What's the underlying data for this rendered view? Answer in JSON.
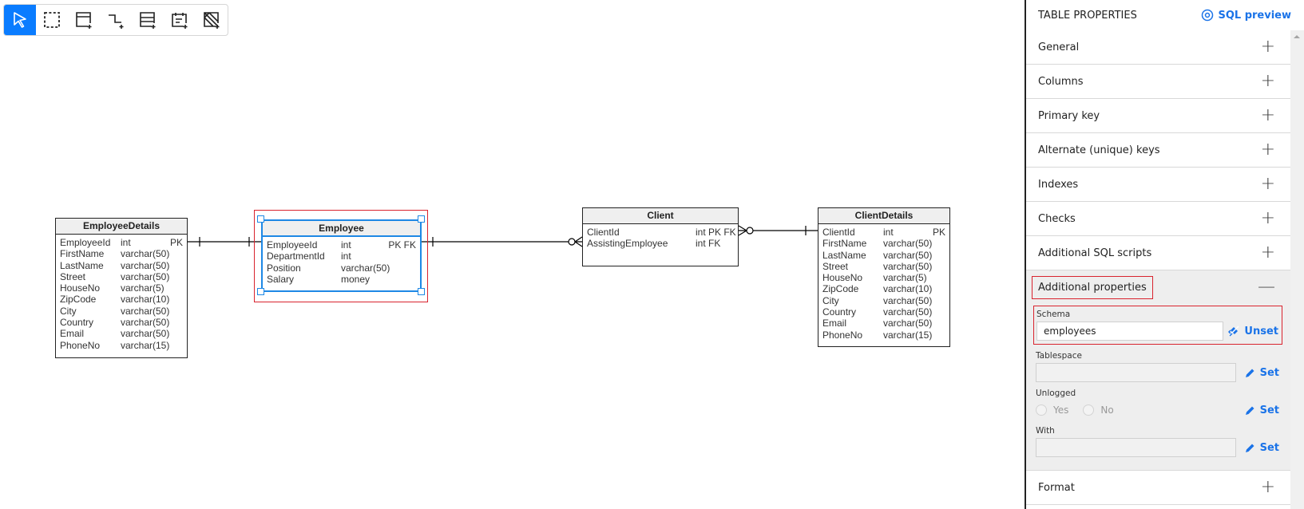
{
  "toolbar": {
    "tools": [
      {
        "name": "select-tool",
        "icon": "pointer-icon",
        "active": true
      },
      {
        "name": "marquee-tool",
        "icon": "dashed-rectangle-icon",
        "active": false
      },
      {
        "name": "add-table-tool",
        "icon": "add-table-icon",
        "active": false
      },
      {
        "name": "add-relationship-tool",
        "icon": "add-relationship-icon",
        "active": false
      },
      {
        "name": "add-view-tool",
        "icon": "add-view-icon",
        "active": false
      },
      {
        "name": "add-note-tool",
        "icon": "add-note-icon",
        "active": false
      },
      {
        "name": "add-area-tool",
        "icon": "add-hatched-area-icon",
        "active": false
      }
    ]
  },
  "diagram": {
    "tables": {
      "employee_details": {
        "name": "EmployeeDetails",
        "columns": [
          {
            "name": "EmployeeId",
            "type": "int",
            "key": "PK"
          },
          {
            "name": "FirstName",
            "type": "varchar(50)",
            "key": ""
          },
          {
            "name": "LastName",
            "type": "varchar(50)",
            "key": ""
          },
          {
            "name": "Street",
            "type": "varchar(50)",
            "key": ""
          },
          {
            "name": "HouseNo",
            "type": "varchar(5)",
            "key": ""
          },
          {
            "name": "ZipCode",
            "type": "varchar(10)",
            "key": ""
          },
          {
            "name": "City",
            "type": "varchar(50)",
            "key": ""
          },
          {
            "name": "Country",
            "type": "varchar(50)",
            "key": ""
          },
          {
            "name": "Email",
            "type": "varchar(50)",
            "key": ""
          },
          {
            "name": "PhoneNo",
            "type": "varchar(15)",
            "key": ""
          }
        ]
      },
      "employee": {
        "name": "Employee",
        "selected": true,
        "columns": [
          {
            "name": "EmployeeId",
            "type": "int",
            "key": "PK FK"
          },
          {
            "name": "DepartmentId",
            "type": "int",
            "key": ""
          },
          {
            "name": "Position",
            "type": "varchar(50)",
            "key": ""
          },
          {
            "name": "Salary",
            "type": "money",
            "key": ""
          }
        ]
      },
      "client": {
        "name": "Client",
        "columns": [
          {
            "name": "ClientId",
            "type": "int PK FK",
            "key": ""
          },
          {
            "name": "AssistingEmployee",
            "type": "int FK",
            "key": ""
          }
        ]
      },
      "client_details": {
        "name": "ClientDetails",
        "columns": [
          {
            "name": "ClientId",
            "type": "int",
            "key": "PK"
          },
          {
            "name": "FirstName",
            "type": "varchar(50)",
            "key": ""
          },
          {
            "name": "LastName",
            "type": "varchar(50)",
            "key": ""
          },
          {
            "name": "Street",
            "type": "varchar(50)",
            "key": ""
          },
          {
            "name": "HouseNo",
            "type": "varchar(5)",
            "key": ""
          },
          {
            "name": "ZipCode",
            "type": "varchar(10)",
            "key": ""
          },
          {
            "name": "City",
            "type": "varchar(50)",
            "key": ""
          },
          {
            "name": "Country",
            "type": "varchar(50)",
            "key": ""
          },
          {
            "name": "Email",
            "type": "varchar(50)",
            "key": ""
          },
          {
            "name": "PhoneNo",
            "type": "varchar(15)",
            "key": ""
          }
        ]
      }
    },
    "relationships": [
      {
        "from": "EmployeeDetails.EmployeeId",
        "to": "Employee.EmployeeId",
        "from_end": "one",
        "to_end": "one"
      },
      {
        "from": "Employee.EmployeeId",
        "to": "Client.AssistingEmployee",
        "from_end": "one",
        "to_end": "zero-or-many"
      },
      {
        "from": "Client.ClientId",
        "to": "ClientDetails.ClientId",
        "from_end": "zero-or-many",
        "to_end": "one"
      }
    ]
  },
  "panel": {
    "title": "TABLE PROPERTIES",
    "sql_preview_label": "SQL preview",
    "sections": [
      {
        "label": "General",
        "toggle": "+"
      },
      {
        "label": "Columns",
        "toggle": "+"
      },
      {
        "label": "Primary key",
        "toggle": "+"
      },
      {
        "label": "Alternate (unique) keys",
        "toggle": "+"
      },
      {
        "label": "Indexes",
        "toggle": "+"
      },
      {
        "label": "Checks",
        "toggle": "+"
      },
      {
        "label": "Additional SQL scripts",
        "toggle": "+"
      },
      {
        "label": "Additional properties",
        "toggle": "—"
      },
      {
        "label": "Format",
        "toggle": "+"
      }
    ],
    "additional_properties": {
      "schema": {
        "label": "Schema",
        "value": "employees",
        "action": "Unset"
      },
      "tablespace": {
        "label": "Tablespace",
        "value": "",
        "action": "Set"
      },
      "unlogged": {
        "label": "Unlogged",
        "options": [
          "Yes",
          "No"
        ],
        "action": "Set"
      },
      "with": {
        "label": "With",
        "value": "",
        "action": "Set"
      }
    }
  },
  "colors": {
    "accent": "#0a7cff",
    "link": "#1a73e8",
    "selection": "#1e88e5",
    "highlight": "#d9232e"
  }
}
